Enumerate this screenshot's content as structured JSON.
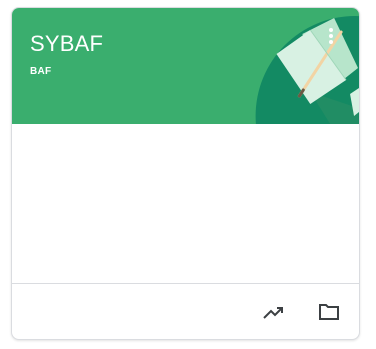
{
  "class_card": {
    "title": "SYBAF",
    "section": "BAF",
    "header_color": "#3aae6e",
    "header_accent_color": "#138a63",
    "menu_icon": "more-vert-icon",
    "footer": {
      "trend_icon": "trending-up-icon",
      "folder_icon": "folder-icon"
    }
  }
}
